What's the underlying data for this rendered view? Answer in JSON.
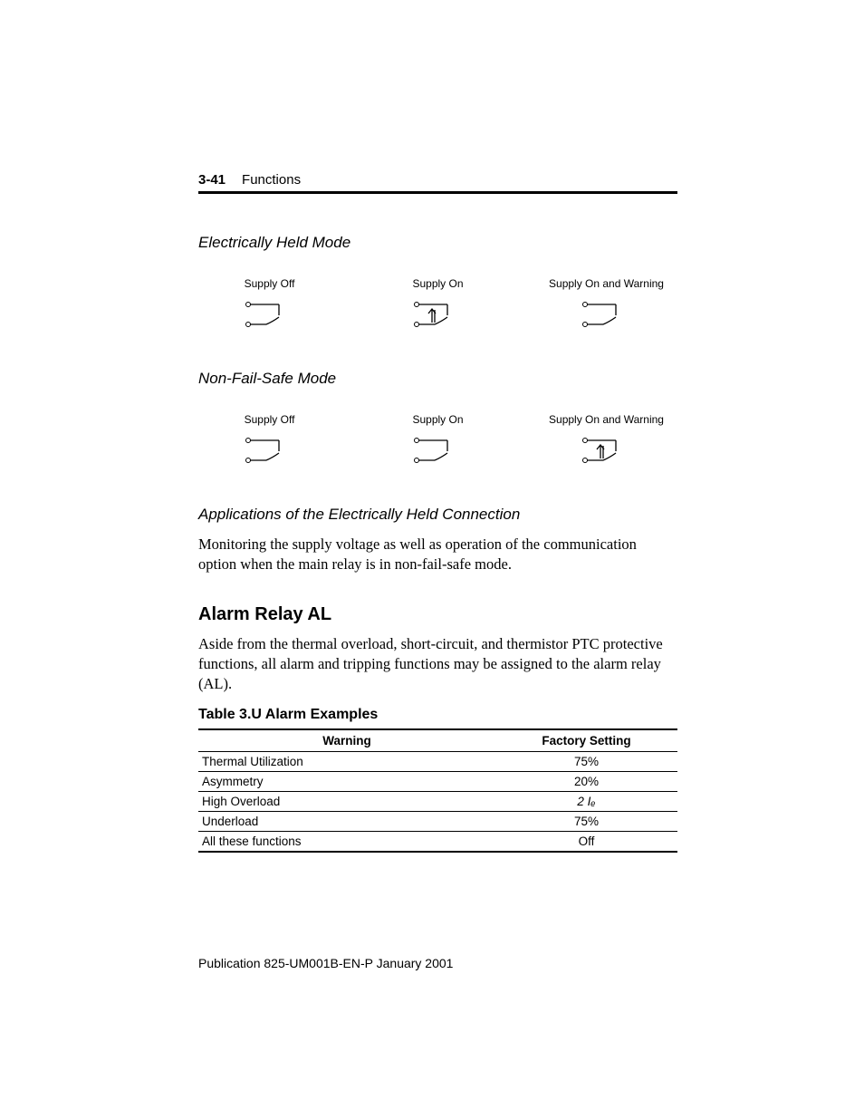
{
  "header": {
    "page_number": "3-41",
    "chapter": "Functions"
  },
  "sections": {
    "electrically_held": "Electrically Held Mode",
    "non_fail_safe": "Non-Fail-Safe Mode",
    "applications_title": "Applications of the Electrically Held Connection",
    "applications_body": "Monitoring the supply voltage as well as operation of the communication option when the main relay is in non-fail-safe mode.",
    "alarm_relay_heading": "Alarm Relay AL",
    "alarm_relay_body": "Aside from the thermal overload, short-circuit, and thermistor PTC protective functions, all alarm and tripping functions may be assigned to the alarm relay (AL).",
    "table_title": "Table 3.U Alarm Examples"
  },
  "relay_labels": {
    "supply_off": "Supply Off",
    "supply_on": "Supply On",
    "supply_on_warn": "Supply On and Warning"
  },
  "table": {
    "col_warning": "Warning",
    "col_factory": "Factory Setting",
    "rows": [
      {
        "warning": "Thermal Utilization",
        "setting": "75%"
      },
      {
        "warning": "Asymmetry",
        "setting": "20%"
      },
      {
        "warning": "High Overload",
        "setting": "2 Iₑ"
      },
      {
        "warning": "Underload",
        "setting": "75%"
      },
      {
        "warning": "All these functions",
        "setting": "Off"
      }
    ]
  },
  "footer": {
    "publication": "Publication 825-UM001B-EN-P  January 2001"
  },
  "chart_data": [
    {
      "type": "table",
      "title": "Table 3.U Alarm Examples",
      "columns": [
        "Warning",
        "Factory Setting"
      ],
      "rows": [
        [
          "Thermal Utilization",
          "75%"
        ],
        [
          "Asymmetry",
          "20%"
        ],
        [
          "High Overload",
          "2 Ie"
        ],
        [
          "Underload",
          "75%"
        ],
        [
          "All these functions",
          "Off"
        ]
      ]
    }
  ]
}
